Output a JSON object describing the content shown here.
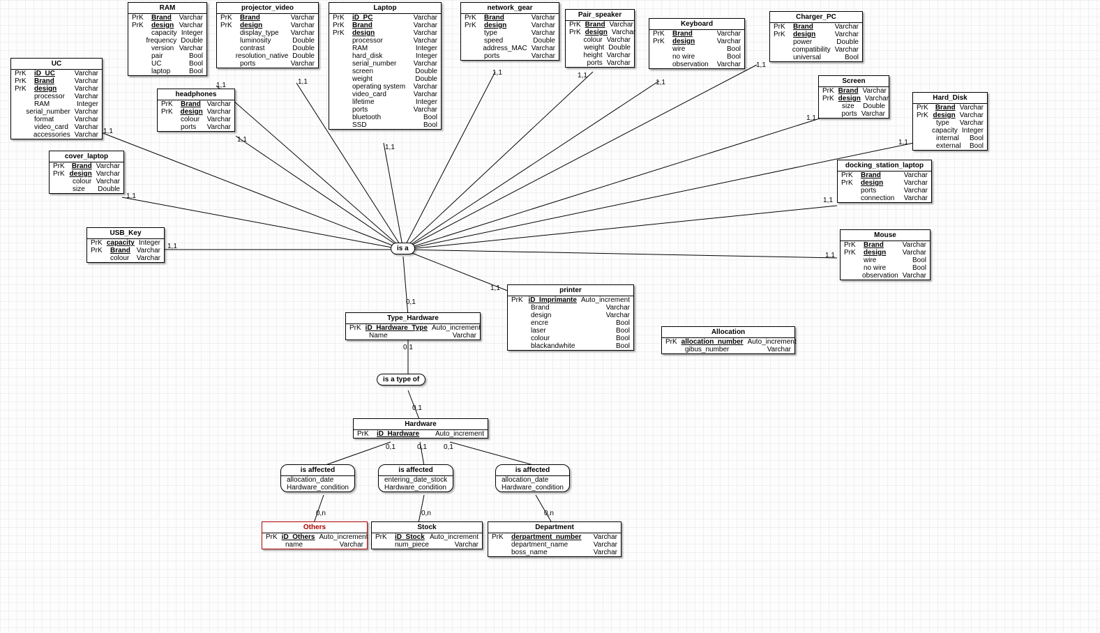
{
  "entities": {
    "UC": {
      "title": "UC",
      "attrs": [
        {
          "k": "PrK",
          "n": "iD_UC",
          "t": "Varchar",
          "pk": true
        },
        {
          "k": "PrK",
          "n": "Brand",
          "t": "Varchar",
          "pk": true
        },
        {
          "k": "PrK",
          "n": "design",
          "t": "Varchar",
          "pk": true
        },
        {
          "k": "",
          "n": "processor",
          "t": "Varchar"
        },
        {
          "k": "",
          "n": "RAM",
          "t": "Integer"
        },
        {
          "k": "",
          "n": "serial_number",
          "t": "Varchar"
        },
        {
          "k": "",
          "n": "format",
          "t": "Varchar"
        },
        {
          "k": "",
          "n": "video_card",
          "t": "Varchar"
        },
        {
          "k": "",
          "n": "accessories",
          "t": "Varchar"
        }
      ]
    },
    "RAM": {
      "title": "RAM",
      "attrs": [
        {
          "k": "PrK",
          "n": "Brand",
          "t": "Varchar",
          "pk": true
        },
        {
          "k": "PrK",
          "n": "design",
          "t": "Varchar",
          "pk": true
        },
        {
          "k": "",
          "n": "capacity",
          "t": "Integer"
        },
        {
          "k": "",
          "n": "frequency",
          "t": "Double"
        },
        {
          "k": "",
          "n": "version",
          "t": "Varchar"
        },
        {
          "k": "",
          "n": "pair",
          "t": "Bool"
        },
        {
          "k": "",
          "n": "UC",
          "t": "Bool"
        },
        {
          "k": "",
          "n": "laptop",
          "t": "Bool"
        }
      ]
    },
    "projector_video": {
      "title": "projector_video",
      "attrs": [
        {
          "k": "PrK",
          "n": "Brand",
          "t": "Varchar",
          "pk": true
        },
        {
          "k": "PrK",
          "n": "design",
          "t": "Varchar",
          "pk": true
        },
        {
          "k": "",
          "n": "display_type",
          "t": "Varchar"
        },
        {
          "k": "",
          "n": "luminosity",
          "t": "Double"
        },
        {
          "k": "",
          "n": "contrast",
          "t": "Double"
        },
        {
          "k": "",
          "n": "resolution_native",
          "t": "Double"
        },
        {
          "k": "",
          "n": "ports",
          "t": "Varchar"
        }
      ]
    },
    "Laptop": {
      "title": "Laptop",
      "attrs": [
        {
          "k": "PrK",
          "n": "iD_PC",
          "t": "Varchar",
          "pk": true
        },
        {
          "k": "PrK",
          "n": "Brand",
          "t": "Varchar",
          "pk": true
        },
        {
          "k": "PrK",
          "n": "design",
          "t": "Varchar",
          "pk": true
        },
        {
          "k": "",
          "n": "processor",
          "t": "Varchar"
        },
        {
          "k": "",
          "n": "RAM",
          "t": "Integer"
        },
        {
          "k": "",
          "n": "hard_disk",
          "t": "Integer"
        },
        {
          "k": "",
          "n": "serial_number",
          "t": "Varchar"
        },
        {
          "k": "",
          "n": "screen",
          "t": "Double"
        },
        {
          "k": "",
          "n": "weight",
          "t": "Double"
        },
        {
          "k": "",
          "n": "operating system",
          "t": "Varchar"
        },
        {
          "k": "",
          "n": "video_card",
          "t": "Varchar"
        },
        {
          "k": "",
          "n": "lifetime",
          "t": "Integer"
        },
        {
          "k": "",
          "n": "ports",
          "t": "Varchar"
        },
        {
          "k": "",
          "n": "bluetooth",
          "t": "Bool"
        },
        {
          "k": "",
          "n": "SSD",
          "t": "Bool"
        }
      ]
    },
    "network_gear": {
      "title": "network_gear",
      "attrs": [
        {
          "k": "PrK",
          "n": "Brand",
          "t": "Varchar",
          "pk": true
        },
        {
          "k": "PrK",
          "n": "design",
          "t": "Varchar",
          "pk": true
        },
        {
          "k": "",
          "n": "type",
          "t": "Varchar"
        },
        {
          "k": "",
          "n": "speed",
          "t": "Double"
        },
        {
          "k": "",
          "n": "address_MAC",
          "t": "Varchar"
        },
        {
          "k": "",
          "n": "ports",
          "t": "Varchar"
        }
      ]
    },
    "Pair_speaker": {
      "title": "Pair_speaker",
      "attrs": [
        {
          "k": "PrK",
          "n": "Brand",
          "t": "Varchar",
          "pk": true
        },
        {
          "k": "PrK",
          "n": "design",
          "t": "Varchar",
          "pk": true
        },
        {
          "k": "",
          "n": "colour",
          "t": "Varchar"
        },
        {
          "k": "",
          "n": "weight",
          "t": "Double"
        },
        {
          "k": "",
          "n": "height",
          "t": "Varchar"
        },
        {
          "k": "",
          "n": "ports",
          "t": "Varchar"
        }
      ]
    },
    "Keyboard": {
      "title": "Keyboard",
      "attrs": [
        {
          "k": "PrK",
          "n": "Brand",
          "t": "Varchar",
          "pk": true
        },
        {
          "k": "PrK",
          "n": "design",
          "t": "Varchar",
          "pk": true
        },
        {
          "k": "",
          "n": "wire",
          "t": "Bool"
        },
        {
          "k": "",
          "n": "no wire",
          "t": "Bool"
        },
        {
          "k": "",
          "n": "observation",
          "t": "Varchar"
        }
      ]
    },
    "Charger_PC": {
      "title": "Charger_PC",
      "attrs": [
        {
          "k": "PrK",
          "n": "Brand",
          "t": "Varchar",
          "pk": true
        },
        {
          "k": "PrK",
          "n": "design",
          "t": "Varchar",
          "pk": true
        },
        {
          "k": "",
          "n": "power",
          "t": "Double"
        },
        {
          "k": "",
          "n": "compatibility",
          "t": "Varchar"
        },
        {
          "k": "",
          "n": "universal",
          "t": "Bool"
        }
      ]
    },
    "headphones": {
      "title": "headphones",
      "attrs": [
        {
          "k": "PrK",
          "n": "Brand",
          "t": "Varchar",
          "pk": true
        },
        {
          "k": "PrK",
          "n": "design",
          "t": "Varchar",
          "pk": true
        },
        {
          "k": "",
          "n": "colour",
          "t": "Varchar"
        },
        {
          "k": "",
          "n": "ports",
          "t": "Varchar"
        }
      ]
    },
    "cover_laptop": {
      "title": "cover_laptop",
      "attrs": [
        {
          "k": "PrK",
          "n": "Brand",
          "t": "Varchar",
          "pk": true
        },
        {
          "k": "PrK",
          "n": "design",
          "t": "Varchar",
          "pk": true
        },
        {
          "k": "",
          "n": "colour",
          "t": "Varchar"
        },
        {
          "k": "",
          "n": "size",
          "t": "Double"
        }
      ]
    },
    "USB_Key": {
      "title": "USB_Key",
      "attrs": [
        {
          "k": "PrK",
          "n": "capacity",
          "t": "Integer",
          "pk": true
        },
        {
          "k": "PrK",
          "n": "Brand",
          "t": "Varchar",
          "pk": true
        },
        {
          "k": "",
          "n": "colour",
          "t": "Varchar"
        }
      ]
    },
    "Screen": {
      "title": "Screen",
      "attrs": [
        {
          "k": "PrK",
          "n": "Brand",
          "t": "Varchar",
          "pk": true
        },
        {
          "k": "PrK",
          "n": "design",
          "t": "Varchar",
          "pk": true
        },
        {
          "k": "",
          "n": "size",
          "t": "Double"
        },
        {
          "k": "",
          "n": "ports",
          "t": "Varchar"
        }
      ]
    },
    "Hard_Disk": {
      "title": "Hard_Disk",
      "attrs": [
        {
          "k": "PrK",
          "n": "Brand",
          "t": "Varchar",
          "pk": true
        },
        {
          "k": "PrK",
          "n": "design",
          "t": "Varchar",
          "pk": true
        },
        {
          "k": "",
          "n": "type",
          "t": "Varchar"
        },
        {
          "k": "",
          "n": "capacity",
          "t": "Integer"
        },
        {
          "k": "",
          "n": "internal",
          "t": "Bool"
        },
        {
          "k": "",
          "n": "external",
          "t": "Bool"
        }
      ]
    },
    "docking_station_laptop": {
      "title": "docking_station_laptop",
      "attrs": [
        {
          "k": "PrK",
          "n": "Brand",
          "t": "Varchar",
          "pk": true
        },
        {
          "k": "PrK",
          "n": "design",
          "t": "Varchar",
          "pk": true
        },
        {
          "k": "",
          "n": "ports",
          "t": "Varchar"
        },
        {
          "k": "",
          "n": "connection",
          "t": "Varchar"
        }
      ]
    },
    "Mouse": {
      "title": "Mouse",
      "attrs": [
        {
          "k": "PrK",
          "n": "Brand",
          "t": "Varchar",
          "pk": true
        },
        {
          "k": "PrK",
          "n": "design",
          "t": "Varchar",
          "pk": true
        },
        {
          "k": "",
          "n": "wire",
          "t": "Bool"
        },
        {
          "k": "",
          "n": "no wire",
          "t": "Bool"
        },
        {
          "k": "",
          "n": "observation",
          "t": "Varchar"
        }
      ]
    },
    "printer": {
      "title": "printer",
      "attrs": [
        {
          "k": "PrK",
          "n": "iD_Imprimante",
          "t": "Auto_increment",
          "pk": true
        },
        {
          "k": "",
          "n": "Brand",
          "t": "Varchar"
        },
        {
          "k": "",
          "n": "design",
          "t": "Varchar"
        },
        {
          "k": "",
          "n": "encre",
          "t": "Bool"
        },
        {
          "k": "",
          "n": "laser",
          "t": "Bool"
        },
        {
          "k": "",
          "n": "colour",
          "t": "Bool"
        },
        {
          "k": "",
          "n": "blackandwhite",
          "t": "Bool"
        }
      ]
    },
    "Type_Hardware": {
      "title": "Type_Hardware",
      "attrs": [
        {
          "k": "PrK",
          "n": "iD_Hardware_Type",
          "t": "Auto_increment",
          "pk": true
        },
        {
          "k": "",
          "n": "Name",
          "t": "Varchar"
        }
      ]
    },
    "Hardware": {
      "title": "Hardware",
      "attrs": [
        {
          "k": "PrK",
          "n": "iD_Hardware",
          "t": "Auto_increment",
          "pk": true
        }
      ]
    },
    "Allocation": {
      "title": "Allocation",
      "attrs": [
        {
          "k": "PrK",
          "n": "allocation_number",
          "t": "Auto_increment",
          "pk": true
        },
        {
          "k": "",
          "n": "gibus_number",
          "t": "Varchar"
        }
      ]
    },
    "Others": {
      "title": "Others",
      "selected": true,
      "attrs": [
        {
          "k": "PrK",
          "n": "iD_Others",
          "t": "Auto_increment",
          "pk": true
        },
        {
          "k": "",
          "n": "name",
          "t": "Varchar"
        }
      ]
    },
    "Stock": {
      "title": "Stock",
      "attrs": [
        {
          "k": "PrK",
          "n": "iD_Stock",
          "t": "Auto_increment",
          "pk": true
        },
        {
          "k": "",
          "n": "num_piece",
          "t": "Varchar"
        }
      ]
    },
    "Department": {
      "title": "Department",
      "attrs": [
        {
          "k": "PrK",
          "n": "derpartment_number",
          "t": "Varchar",
          "pk": true
        },
        {
          "k": "",
          "n": "department_name",
          "t": "Varchar"
        },
        {
          "k": "",
          "n": "boss_name",
          "t": "Varchar"
        }
      ]
    }
  },
  "relations": {
    "isa": {
      "title": "is a"
    },
    "istype": {
      "title": "is a type of"
    },
    "aff1": {
      "title": "is affected",
      "attrs": [
        "allocation_date",
        "Hardware_condition"
      ]
    },
    "aff2": {
      "title": "is affected",
      "attrs": [
        "entering_date_stock",
        "Hardware_condition"
      ]
    },
    "aff3": {
      "title": "is affected",
      "attrs": [
        "allocation_date",
        "Hardware_condition"
      ]
    }
  },
  "cards": {
    "c11": "1,1",
    "c01": "0,1",
    "c0n": "0,n"
  }
}
